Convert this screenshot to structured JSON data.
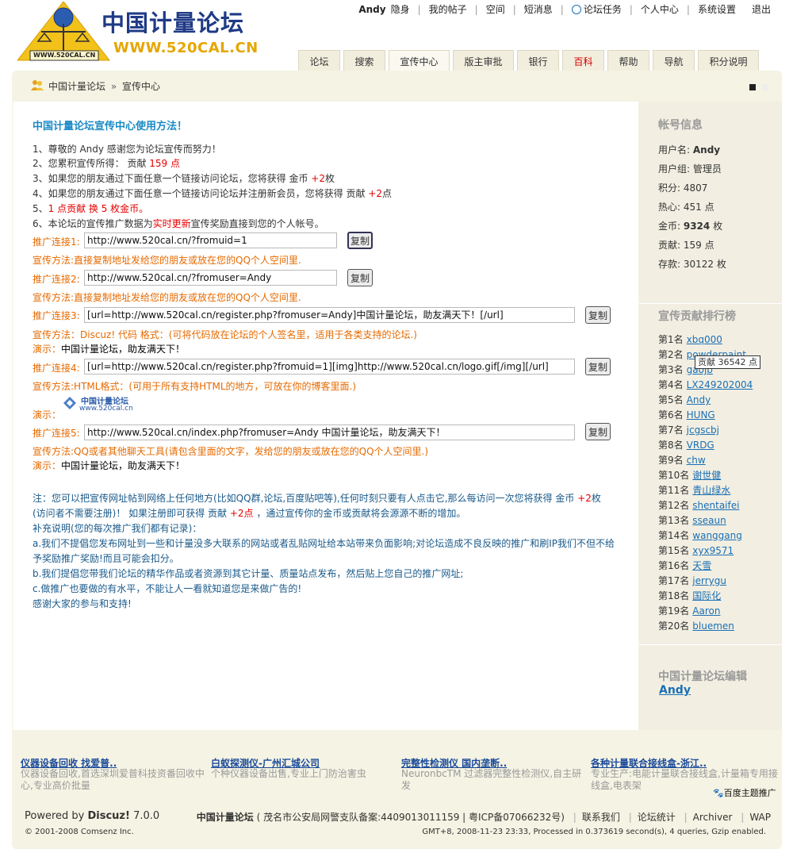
{
  "header": {
    "logo_title": "中国计量论坛",
    "logo_url": "WWW.520CAL.CN",
    "logo_badge": "WWW.520CAL.CN",
    "user": "Andy",
    "status": "隐身",
    "links": [
      "我的帖子",
      "空间",
      "短消息",
      "论坛任务",
      "个人中心",
      "系统设置",
      "退出"
    ]
  },
  "nav": {
    "tabs": [
      "论坛",
      "搜索",
      "宣传中心",
      "版主审批",
      "银行",
      "百科",
      "帮助",
      "导航",
      "积分说明"
    ]
  },
  "breadcrumb": {
    "home": "中国计量论坛",
    "sep": "»",
    "current": "宣传中心"
  },
  "main": {
    "title": "中国计量论坛宣传中心使用方法！",
    "lines": {
      "l1": "1、尊敬的 Andy 感谢您为论坛宣传而努力！",
      "l2_pre": "2、您累积宣传所得：  贡献 ",
      "l2_val": "159 点",
      "l3_pre": "3、如果您的朋友通过下面任意一个链接访问论坛，您将获得 金币 ",
      "l3_val": "+2",
      "l3_post": "枚",
      "l4_pre": "4、如果您的朋友通过下面任意一个链接访问论坛并注册新会员，您将获得 贡献 ",
      "l4_val": "+2",
      "l4_post": "点",
      "l5_pre": "5、",
      "l5_val": "1 点贡献 换 5 枚金币。",
      "l6_pre": "6、本论坛的宣传推广数据为",
      "l6_val": "实时更新",
      "l6_post": "宣传奖励直接到您的个人帐号。"
    },
    "links": [
      {
        "label": "推广连接1:",
        "url": "http://www.520cal.cn/?fromuid=1",
        "method": "宣传方法:直接复制地址发给您的朋友或放在您的QQ个人空间里."
      },
      {
        "label": "推广连接2:",
        "url": "http://www.520cal.cn/?fromuser=Andy",
        "method": "宣传方法:直接复制地址发给您的朋友或放在您的QQ个人空间里."
      },
      {
        "label": "推广连接3:",
        "url": "[url=http://www.520cal.cn/register.php?fromuser=Andy]中国计量论坛，助友满天下！[/url]",
        "method": "宣传方法：Discuz! 代码 格式：(可将代码放在论坛的个人签名里，适用于各类支持的论坛.)",
        "demo_label": "演示：",
        "demo_text": "中国计量论坛，助友满天下！"
      },
      {
        "label": "推广连接4:",
        "url": "[url=http://www.520cal.cn/register.php?fromuid=1][img]http://www.520cal.cn/logo.gif[/img][/url]",
        "method": "宣传方法:HTML格式：(可用于所有支持HTML的地方，可放在你的博客里面.)",
        "demo_label": "演示：",
        "demo_logo_title": "中国计量论坛",
        "demo_logo_url": "www.520cal.cn"
      },
      {
        "label": "推广连接5:",
        "url": "http://www.520cal.cn/index.php?fromuser=Andy 中国计量论坛，助友满天下！",
        "method": "宣传方法:QQ或者其他聊天工具(请包含里面的文字，发给您的朋友或放在您的QQ个人空间里.)",
        "demo_label": "演示：",
        "demo_text": "中国计量论坛，助友满天下！"
      }
    ],
    "copy_label": "复制",
    "notes": {
      "n1_pre": "注：您可以把宣传网址帖到网络上任何地方(比如QQ群,论坛,百度贴吧等),任何时刻只要有人点击它,那么每访问一次您将获得 金币 ",
      "n1_val": "+2",
      "n1_post": "枚",
      "n2_pre": "(访问者不需要注册)！ 如果注册即可获得 贡献 ",
      "n2_val": "+2点",
      "n2_post": " ，通过宣传你的金币或贡献将会源源不断的增加。",
      "n3": "补充说明(您的每次推广我们都有记录)：",
      "n4": "a.我们不提倡您发布网址到一些和计量没多大联系的网站或者乱贴网址给本站带来负面影响;对论坛造成不良反映的推广和刷IP我们不但不给",
      "n5": "予奖励推广奖励!而且可能会扣分。",
      "n6": "b.我们提倡您带我们论坛的精华作品或者资源到其它计量、质量站点发布，然后贴上您自己的推广网址;",
      "n7": "c.做推广也要做的有水平，不能让人一看就知道您是来做广告的!",
      "n8": "感谢大家的参与和支持!"
    }
  },
  "sidebar": {
    "account_title": "帐号信息",
    "account": {
      "username_label": "用户名: ",
      "username": "Andy",
      "group": "用户组: 管理员",
      "points": "积分: 4807",
      "heart": "热心: 451 点",
      "gold_label": "金币: ",
      "gold": "9324",
      "gold_unit": " 枚",
      "contrib": "贡献: 159 点",
      "deposit": "存款: 30122 枚"
    },
    "ranking_title": "宣传贡献排行榜",
    "ranking": [
      {
        "rank": "第1名",
        "name": "xbq000"
      },
      {
        "rank": "第2名",
        "name": "powderpaint"
      },
      {
        "rank": "第3名",
        "name": "gaojb"
      },
      {
        "rank": "第4名",
        "name": "LX249202004"
      },
      {
        "rank": "第5名",
        "name": "Andy"
      },
      {
        "rank": "第6名",
        "name": "HUNG"
      },
      {
        "rank": "第7名",
        "name": "jcgscbj"
      },
      {
        "rank": "第8名",
        "name": "VRDG"
      },
      {
        "rank": "第9名",
        "name": "chw"
      },
      {
        "rank": "第10名",
        "name": "谢世健"
      },
      {
        "rank": "第11名",
        "name": "青山绿水"
      },
      {
        "rank": "第12名",
        "name": "shentaifei"
      },
      {
        "rank": "第13名",
        "name": "sseaun"
      },
      {
        "rank": "第14名",
        "name": "wanggang"
      },
      {
        "rank": "第15名",
        "name": "xyx9571"
      },
      {
        "rank": "第16名",
        "name": "天雪"
      },
      {
        "rank": "第17名",
        "name": "jerrygu"
      },
      {
        "rank": "第18名",
        "name": "国际化"
      },
      {
        "rank": "第19名",
        "name": "Aaron"
      },
      {
        "rank": "第20名",
        "name": "bluemen"
      }
    ],
    "tooltip": "贡献 36542 点",
    "editor_title": "中国计量论坛编辑",
    "editor_name": "Andy"
  },
  "ads": [
    {
      "title": "仪器设备回收 找爱普..",
      "desc": "仪器设备回收,首选深圳爱普科技资番回收中心,专业高价批量"
    },
    {
      "title": "白蚁探测仪-广州汇城公司",
      "desc": "个种仪器设备出售,专业上门防治害虫"
    },
    {
      "title": "完整性检测仪 国内垄断..",
      "desc": "NeuronbcTM 过滤器完整性检测仪,自主研发"
    },
    {
      "title": "各种计量联合接线盒-浙江..",
      "desc": "专业生产:电能计量联合接线盒,计量箱专用接线盒,电表架"
    }
  ],
  "baidu": "百度主题推广",
  "footer": {
    "powered_pre": "Powered by ",
    "powered_brand": "Discuz!",
    "powered_ver": " 7.0.0",
    "copyright": "© 2001-2008 Comsenz Inc.",
    "site": "中国计量论坛",
    "record": " ( 茂名市公安局网警支队备案:4409013011159 | 粤ICP备07066232号)",
    "links": [
      "联系我们",
      "论坛统计",
      "Archiver",
      "WAP"
    ],
    "gmt": "GMT+8, 2008-11-23 23:33, Processed in 0.373619 second(s), 4 queries, Gzip enabled."
  }
}
